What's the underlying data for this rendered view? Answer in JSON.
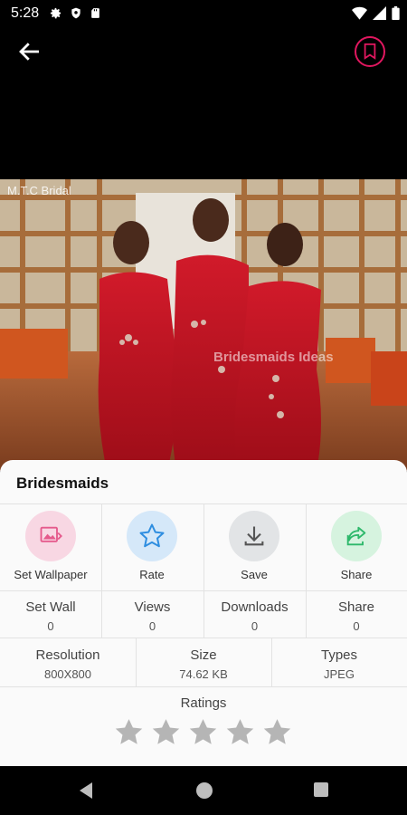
{
  "status_bar": {
    "time": "5:28"
  },
  "image": {
    "watermark_top": "M.T.C Bridal",
    "watermark_center": "Bridesmaids Ideas"
  },
  "sheet": {
    "title": "Bridesmaids",
    "actions": [
      {
        "label": "Set Wallpaper",
        "icon": "wallpaper-icon",
        "bg": "#f8d7e3"
      },
      {
        "label": "Rate",
        "icon": "star-icon",
        "bg": "#d5e8f9"
      },
      {
        "label": "Save",
        "icon": "download-icon",
        "bg": "#e2e4e6"
      },
      {
        "label": "Share",
        "icon": "share-icon",
        "bg": "#d6f3df"
      }
    ],
    "stats": [
      {
        "label": "Set Wall",
        "value": "0"
      },
      {
        "label": "Views",
        "value": "0"
      },
      {
        "label": "Downloads",
        "value": "0"
      },
      {
        "label": "Share",
        "value": "0"
      }
    ],
    "info": [
      {
        "label": "Resolution",
        "value": "800X800"
      },
      {
        "label": "Size",
        "value": "74.62 KB"
      },
      {
        "label": "Types",
        "value": "JPEG"
      }
    ],
    "ratings_label": "Ratings",
    "rating": 0,
    "rating_max": 5
  },
  "colors": {
    "accent": "#e0175f",
    "star_empty": "#b5b5b5"
  }
}
